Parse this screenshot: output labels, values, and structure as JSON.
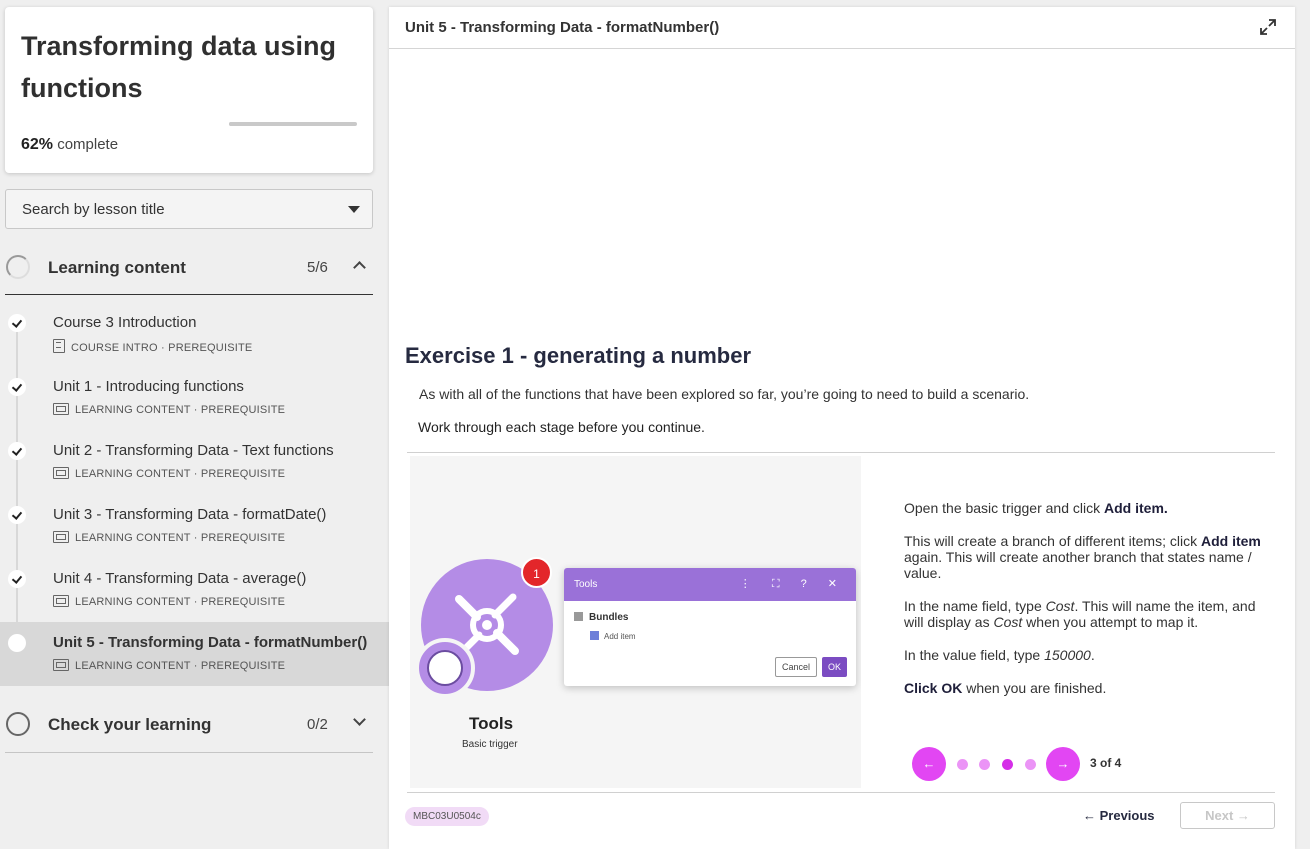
{
  "course": {
    "title": "Transforming data using functions",
    "progress_percent": "62%",
    "progress_label": "complete",
    "progress_fraction": 0.62
  },
  "search": {
    "placeholder": "Search by lesson title"
  },
  "sections": [
    {
      "title": "Learning content",
      "count": "5/6",
      "expanded": true
    },
    {
      "title": "Check your learning",
      "count": "0/2",
      "expanded": false
    }
  ],
  "lessons": [
    {
      "title": "Course 3 Introduction",
      "type": "COURSE INTRO",
      "tag": "PREREQUISITE",
      "completed": true,
      "icon": "document-icon"
    },
    {
      "title": "Unit 1 - Introducing functions",
      "type": "LEARNING CONTENT",
      "tag": "PREREQUISITE",
      "completed": true,
      "icon": "slides-icon"
    },
    {
      "title": "Unit 2 - Transforming Data - Text functions",
      "type": "LEARNING CONTENT",
      "tag": "PREREQUISITE",
      "completed": true,
      "icon": "slides-icon"
    },
    {
      "title": "Unit 3 - Transforming Data - formatDate()",
      "type": "LEARNING CONTENT",
      "tag": "PREREQUISITE",
      "completed": true,
      "icon": "slides-icon"
    },
    {
      "title": "Unit 4 - Transforming Data - average()",
      "type": "LEARNING CONTENT",
      "tag": "PREREQUISITE",
      "completed": true,
      "icon": "slides-icon"
    },
    {
      "title": "Unit 5 - Transforming Data - formatNumber()",
      "type": "LEARNING CONTENT",
      "tag": "PREREQUISITE",
      "completed": false,
      "active": true,
      "icon": "slides-icon"
    }
  ],
  "meta_separator": "·",
  "main": {
    "unit_title": "Unit 5 - Transforming Data - formatNumber()",
    "exercise_title": "Exercise 1 - generating a number",
    "intro": "As with all of the functions that have been explored so far, you’re going to need to build a scenario.",
    "instruction": "Work through each stage before you continue."
  },
  "illustration": {
    "badge": "1",
    "label": "Tools",
    "sublabel": "Basic trigger",
    "dialog_title": "Tools",
    "dialog_controls": "⋮ ⛶ ? ✕",
    "bundles": "Bundles",
    "add_item": "Add item",
    "cancel": "Cancel",
    "ok": "OK"
  },
  "steps": {
    "s1_pre": "Open the basic trigger and click ",
    "s1_bold": "Add item.",
    "s2_pre": "This will create a branch of different items; click ",
    "s2_bold": "Add item",
    "s2_post": " again. This will create another branch that states name / value.",
    "s3_pre": "In the name field, type ",
    "s3_em": "Cost",
    "s3_mid": ". This will name the item, and will display as ",
    "s3_em2": "Cost",
    "s3_post": " when you attempt to map it.",
    "s4_pre": "In the value field, type ",
    "s4_em": "150000",
    "s4_post": ".",
    "s5_bold": "Click OK",
    "s5_post": " when you are finished."
  },
  "carousel": {
    "prev_arrow": "←",
    "next_arrow": "→",
    "page_indicator": "3 of 4",
    "total": 4,
    "current": 3
  },
  "footer": {
    "code": "MBC03U0504c",
    "previous": "← Previous",
    "next": "Next →"
  },
  "colors": {
    "accent_magenta": "#e246f3",
    "tag_bg": "#f1dbf6",
    "purple": "#9a71d8"
  }
}
